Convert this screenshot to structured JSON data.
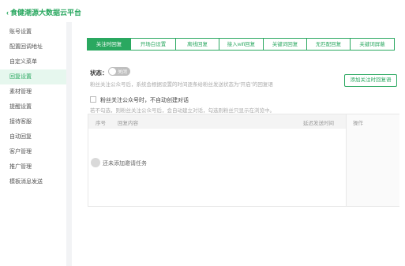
{
  "header": {
    "back_label": "食健潮源大数据云平台"
  },
  "sidebar": {
    "items": [
      {
        "label": "账号设置"
      },
      {
        "label": "配置回调地址"
      },
      {
        "label": "自定义菜单"
      },
      {
        "label": "回复设置",
        "active": true
      },
      {
        "label": "素材管理"
      },
      {
        "label": "提醒设置"
      },
      {
        "label": "接待客服"
      },
      {
        "label": "自动回复"
      },
      {
        "label": "客户管理"
      },
      {
        "label": "推广管理"
      },
      {
        "label": "模板消息发送"
      }
    ]
  },
  "tabs": [
    {
      "label": "关注时回复",
      "active": true
    },
    {
      "label": "开场白设置"
    },
    {
      "label": "离线回复"
    },
    {
      "label": "接入wifi回复"
    },
    {
      "label": "关键词回复"
    },
    {
      "label": "无匹配回复"
    },
    {
      "label": "关键词屏蔽"
    }
  ],
  "status": {
    "label": "状态：",
    "toggle_text": "关闭"
  },
  "hint_status": "粉丝关注公众号后，系统会根据设置的时间逐条给粉丝发送状态为“开启”的回复语",
  "add_button": "添加关注时回复语",
  "checkbox_label": "粉丝关注公众号时，不自动创建对话",
  "hint_checkbox": "若不勾选，则粉丝关注公众号后，会自动建立对话，勾选则粉丝只显示在浏览中。",
  "table": {
    "columns": {
      "seq": "序号",
      "content": "回复内容",
      "delay": "延迟发送时间",
      "ops": "操作"
    },
    "empty_text": "还未添加邀请任务"
  },
  "colors": {
    "accent": "#2aa860",
    "active_bg": "#e6f7ee"
  },
  "icons": {
    "back": "chevron-left-icon",
    "empty": "empty-state-icon"
  }
}
